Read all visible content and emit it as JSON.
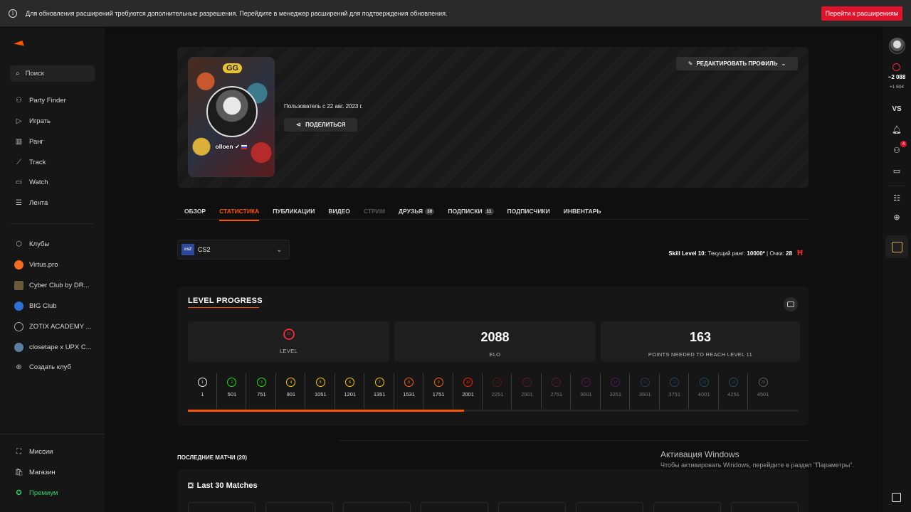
{
  "banner": {
    "message": "Для обновления расширений требуются дополнительные разрешения. Перейдите в менеджер расширений для подтверждения обновления.",
    "button": "Перейти к расширениям"
  },
  "sidebar": {
    "search": "Поиск",
    "nav": [
      {
        "label": "Party Finder",
        "icon": "party-finder-icon"
      },
      {
        "label": "Играть",
        "icon": "play-icon"
      },
      {
        "label": "Ранг",
        "icon": "rank-icon"
      },
      {
        "label": "Track",
        "icon": "track-icon"
      },
      {
        "label": "Watch",
        "icon": "watch-icon"
      },
      {
        "label": "Лента",
        "icon": "feed-icon"
      }
    ],
    "clubs": [
      {
        "label": "Клубы",
        "color": "#444444"
      },
      {
        "label": "Virtus.pro",
        "color": "#f26b21"
      },
      {
        "label": "Cyber Club by DR...",
        "color": "#6b5a3a"
      },
      {
        "label": "BIG Club",
        "color": "#2f6fd6"
      },
      {
        "label": "ZOTIX ACADEMY ...",
        "color": "#888888"
      },
      {
        "label": "closetape x UPX C...",
        "color": "#5a7fa0"
      },
      {
        "label": "Создать клуб",
        "color": "#444444"
      }
    ],
    "bottom": [
      {
        "label": "Миссии"
      },
      {
        "label": "Магазин"
      },
      {
        "label": "Премиум"
      }
    ]
  },
  "profile": {
    "nickname": "olloen",
    "since": "Пользователь с 22 авг. 2023 г.",
    "share": "ПОДЕЛИТЬСЯ",
    "edit": "РЕДАКТИРОВАТЬ ПРОФИЛЬ",
    "cover_text": "GG"
  },
  "tabs": [
    {
      "label": "ОБЗОР"
    },
    {
      "label": "СТАТИСТИКА",
      "active": true
    },
    {
      "label": "ПУБЛИКАЦИИ"
    },
    {
      "label": "ВИДЕО"
    },
    {
      "label": "СТРИМ",
      "disabled": true
    },
    {
      "label": "ДРУЗЬЯ",
      "badge": "30"
    },
    {
      "label": "ПОДПИСКИ",
      "badge": "11"
    },
    {
      "label": "ПОДПИСЧИКИ"
    },
    {
      "label": "ИНВЕНТАРЬ"
    }
  ],
  "game": {
    "icon_text": "cs2",
    "name": "CS2"
  },
  "skill": {
    "level_label": "Skill Level 10:",
    "rank_label": "Текущий ранг:",
    "rank_value": "10000*",
    "points_label": "| Очки:",
    "points_value": "28"
  },
  "level_progress": {
    "title": "LEVEL PROGRESS",
    "level_value": "10",
    "level_label": "LEVEL",
    "elo_value": "2088",
    "elo_label": "ELO",
    "points_value": "163",
    "points_label": "POINTS NEEDED TO REACH LEVEL 11",
    "progress_fraction": 0.452,
    "ticks": [
      {
        "level": "1",
        "value": "1",
        "color": "#eeeeee"
      },
      {
        "level": "2",
        "value": "501",
        "color": "#1ce400"
      },
      {
        "level": "3",
        "value": "751",
        "color": "#1ce400"
      },
      {
        "level": "4",
        "value": "901",
        "color": "#ffc800"
      },
      {
        "level": "5",
        "value": "1051",
        "color": "#ffc800"
      },
      {
        "level": "6",
        "value": "1201",
        "color": "#ffc800"
      },
      {
        "level": "7",
        "value": "1351",
        "color": "#ffc800"
      },
      {
        "level": "8",
        "value": "1531",
        "color": "#ff6309"
      },
      {
        "level": "9",
        "value": "1751",
        "color": "#ff6309"
      },
      {
        "level": "10",
        "value": "2001",
        "color": "#fe1f00"
      },
      {
        "level": "11",
        "value": "2251",
        "color": "#a12121"
      },
      {
        "level": "12",
        "value": "2501",
        "color": "#a12144"
      },
      {
        "level": "13",
        "value": "2751",
        "color": "#a1216b"
      },
      {
        "level": "14",
        "value": "3001",
        "color": "#a1218f"
      },
      {
        "level": "15",
        "value": "3251",
        "color": "#8a21a1"
      },
      {
        "level": "16",
        "value": "3501",
        "color": "#3a5fa1"
      },
      {
        "level": "17",
        "value": "3751",
        "color": "#2b7ab0"
      },
      {
        "level": "18",
        "value": "4001",
        "color": "#2b8ab0"
      },
      {
        "level": "19",
        "value": "4251",
        "color": "#2b8ab0"
      },
      {
        "level": "20",
        "value": "4501",
        "color": "#aaaaaa"
      }
    ]
  },
  "recent": {
    "title": "ПОСЛЕДНИЕ МАТЧИ (20)",
    "panel_title": "Last 30 Matches"
  },
  "watermark": {
    "title": "Активация Windows",
    "text": "Чтобы активировать Windows, перейдите в раздел \"Параметры\"."
  },
  "rail": {
    "elo": "~2 088",
    "diff": "+1 604",
    "vs": "VS",
    "notifications": "4"
  }
}
